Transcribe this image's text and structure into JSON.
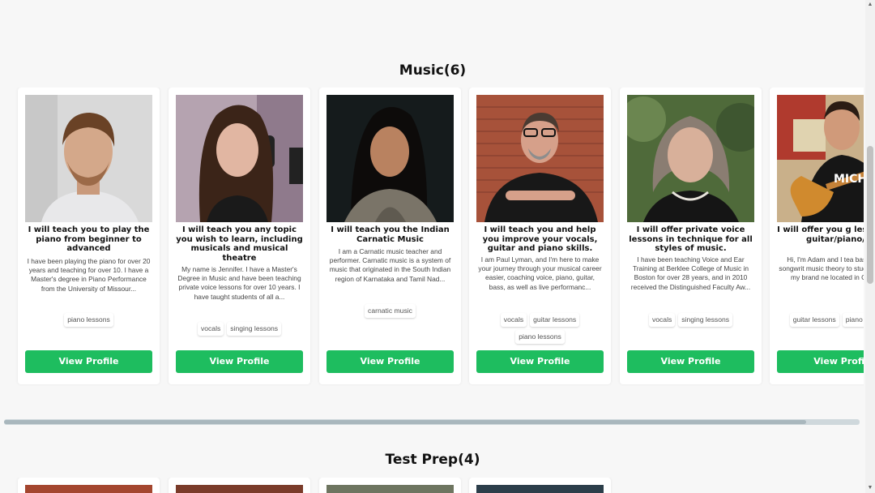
{
  "sections": [
    {
      "title": "Music(6)",
      "cards": [
        {
          "title": "I will teach you to play the piano from beginner to advanced",
          "description": "I have been playing the piano for over 20 years and teaching for over 10. I have a Master's degree in Piano Performance from the University of Missour...",
          "tags": [
            "piano lessons"
          ],
          "button": "View Profile"
        },
        {
          "title": "I will teach you any topic you wish to learn, including musicals and musical theatre",
          "description": "My name is Jennifer. I have a Master's Degree in Music and have been teaching private voice lessons for over 10 years. I have taught students of all a...",
          "tags": [
            "vocals",
            "singing lessons"
          ],
          "button": "View Profile"
        },
        {
          "title": "I will teach you the Indian Carnatic Music",
          "description": "I am a Carnatic music teacher and performer. Carnatic music is a system of music that originated in the South Indian region of Karnataka and Tamil Nad...",
          "tags": [
            "carnatic music"
          ],
          "button": "View Profile"
        },
        {
          "title": "I will teach you and help you improve your vocals, guitar and piano skills.",
          "description": "I am Paul Lyman, and I'm here to make your journey through your musical career easier, coaching voice, piano, guitar, bass, as well as live performanc...",
          "tags": [
            "vocals",
            "guitar lessons",
            "piano lessons"
          ],
          "button": "View Profile"
        },
        {
          "title": "I will offer private voice lessons in technique for all styles of music.",
          "description": "I have been teaching Voice and Ear Training at Berklee College of Music in Boston for over 28 years, and in 2010 received the Distinguished Faculty Aw...",
          "tags": [
            "vocals",
            "singing lessons"
          ],
          "button": "View Profile"
        },
        {
          "title": "I will offer you g lessons for guitar/piano/dr",
          "description": "Hi, I'm Adam and I tea bass, drums, songwrit music theory to studen AGES at my brand ne located in Carlsbad.",
          "tags": [
            "guitar lessons",
            "piano lessons"
          ],
          "button": "View Profil"
        }
      ]
    },
    {
      "title": "Test Prep(4)",
      "cards": [
        {},
        {},
        {},
        {}
      ]
    }
  ],
  "colors": {
    "accent": "#1ebd5f",
    "background": "#f7f7f7",
    "card": "#ffffff"
  }
}
